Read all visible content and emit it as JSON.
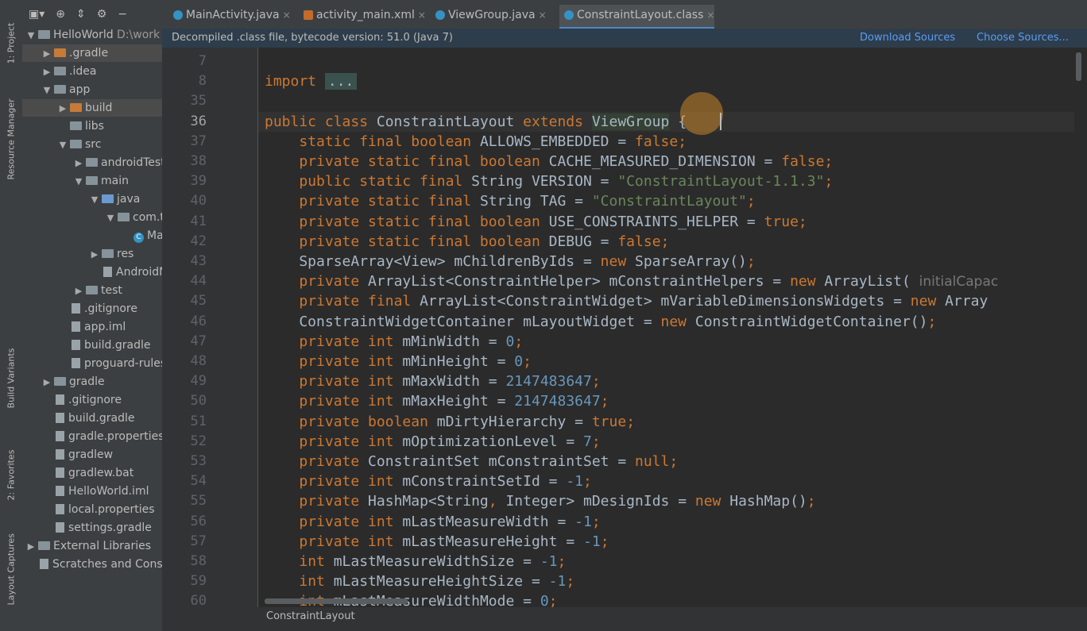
{
  "tool_windows": {
    "project": "1: Project",
    "resource_manager": "Resource Manager",
    "build_variants": "Build Variants",
    "favorites": "2: Favorites",
    "layout_captures": "Layout Captures"
  },
  "project_tree": [
    {
      "label": "HelloWorld",
      "extra": "D:\\work",
      "depth": 0,
      "arrow": "▼",
      "icon": "folder"
    },
    {
      "label": ".gradle",
      "depth": 1,
      "arrow": "▶",
      "icon": "folder-orange",
      "selected": true
    },
    {
      "label": ".idea",
      "depth": 1,
      "arrow": "▶",
      "icon": "folder"
    },
    {
      "label": "app",
      "depth": 1,
      "arrow": "▼",
      "icon": "folder"
    },
    {
      "label": "build",
      "depth": 2,
      "arrow": "▶",
      "icon": "folder-orange",
      "selected": true
    },
    {
      "label": "libs",
      "depth": 2,
      "arrow": "",
      "icon": "folder"
    },
    {
      "label": "src",
      "depth": 2,
      "arrow": "▼",
      "icon": "folder"
    },
    {
      "label": "androidTest",
      "depth": 3,
      "arrow": "▶",
      "icon": "folder"
    },
    {
      "label": "main",
      "depth": 3,
      "arrow": "▼",
      "icon": "folder"
    },
    {
      "label": "java",
      "depth": 4,
      "arrow": "▼",
      "icon": "folder-blue"
    },
    {
      "label": "com.t",
      "depth": 5,
      "arrow": "▼",
      "icon": "folder"
    },
    {
      "label": "Ma",
      "depth": 6,
      "arrow": "",
      "icon": "class"
    },
    {
      "label": "res",
      "depth": 4,
      "arrow": "▶",
      "icon": "folder"
    },
    {
      "label": "AndroidM",
      "depth": 4,
      "arrow": "",
      "icon": "file"
    },
    {
      "label": "test",
      "depth": 3,
      "arrow": "▶",
      "icon": "folder"
    },
    {
      "label": ".gitignore",
      "depth": 2,
      "arrow": "",
      "icon": "file"
    },
    {
      "label": "app.iml",
      "depth": 2,
      "arrow": "",
      "icon": "file"
    },
    {
      "label": "build.gradle",
      "depth": 2,
      "arrow": "",
      "icon": "file"
    },
    {
      "label": "proguard-rules",
      "depth": 2,
      "arrow": "",
      "icon": "file"
    },
    {
      "label": "gradle",
      "depth": 1,
      "arrow": "▶",
      "icon": "folder"
    },
    {
      "label": ".gitignore",
      "depth": 1,
      "arrow": "",
      "icon": "file"
    },
    {
      "label": "build.gradle",
      "depth": 1,
      "arrow": "",
      "icon": "file"
    },
    {
      "label": "gradle.properties",
      "depth": 1,
      "arrow": "",
      "icon": "file"
    },
    {
      "label": "gradlew",
      "depth": 1,
      "arrow": "",
      "icon": "file"
    },
    {
      "label": "gradlew.bat",
      "depth": 1,
      "arrow": "",
      "icon": "file"
    },
    {
      "label": "HelloWorld.iml",
      "depth": 1,
      "arrow": "",
      "icon": "file"
    },
    {
      "label": "local.properties",
      "depth": 1,
      "arrow": "",
      "icon": "file"
    },
    {
      "label": "settings.gradle",
      "depth": 1,
      "arrow": "",
      "icon": "file"
    },
    {
      "label": "External Libraries",
      "depth": 0,
      "arrow": "▶",
      "icon": "lib"
    },
    {
      "label": "Scratches and Conso",
      "depth": 0,
      "arrow": "",
      "icon": "file"
    }
  ],
  "tabs": [
    {
      "label": "MainActivity.java",
      "icon": "class-icon",
      "close": "×"
    },
    {
      "label": "activity_main.xml",
      "icon": "xml-icon",
      "close": "×"
    },
    {
      "label": "ViewGroup.java",
      "icon": "class-icon",
      "close": "×"
    },
    {
      "label": "ConstraintLayout.class",
      "icon": "class-icon",
      "close": "×",
      "active": true
    }
  ],
  "banner": {
    "text": "Decompiled .class file, bytecode version: 51.0 (Java 7)",
    "download": "Download Sources",
    "choose": "Choose Sources..."
  },
  "line_numbers": [
    "7",
    "8",
    "35",
    "36",
    "37",
    "38",
    "39",
    "40",
    "41",
    "42",
    "43",
    "44",
    "45",
    "46",
    "47",
    "48",
    "49",
    "50",
    "51",
    "52",
    "53",
    "54",
    "55",
    "56",
    "57",
    "58",
    "59",
    "60"
  ],
  "current_line": "36",
  "breadcrumb": "ConstraintLayout",
  "colors": {
    "keyword": "#cc7832",
    "string": "#6a8759",
    "number": "#6897bb",
    "text": "#a9b7c6",
    "accent": "#4a88c7"
  },
  "code_lines": [
    [],
    [
      {
        "t": "import",
        "c": "kw"
      },
      {
        "t": " "
      },
      {
        "t": "...",
        "c": "fold"
      }
    ],
    [],
    [
      {
        "t": "public class",
        "c": "kw"
      },
      {
        "t": " ConstraintLayout "
      },
      {
        "t": "extends",
        "c": "kw"
      },
      {
        "t": " "
      },
      {
        "t": "ViewGroup",
        "c": "hl"
      },
      {
        "t": " {"
      }
    ],
    [
      {
        "t": "    "
      },
      {
        "t": "static final boolean",
        "c": "kw"
      },
      {
        "t": " ALLOWS_EMBEDDED = "
      },
      {
        "t": "false",
        "c": "kw"
      },
      {
        "t": ";",
        "c": "kw"
      }
    ],
    [
      {
        "t": "    "
      },
      {
        "t": "private static final boolean",
        "c": "kw"
      },
      {
        "t": " CACHE_MEASURED_DIMENSION = "
      },
      {
        "t": "false",
        "c": "kw"
      },
      {
        "t": ";",
        "c": "kw"
      }
    ],
    [
      {
        "t": "    "
      },
      {
        "t": "public static final",
        "c": "kw"
      },
      {
        "t": " String VERSION = "
      },
      {
        "t": "\"ConstraintLayout-1.1.3\"",
        "c": "st"
      },
      {
        "t": ";",
        "c": "kw"
      }
    ],
    [
      {
        "t": "    "
      },
      {
        "t": "private static final",
        "c": "kw"
      },
      {
        "t": " String TAG = "
      },
      {
        "t": "\"ConstraintLayout\"",
        "c": "st"
      },
      {
        "t": ";",
        "c": "kw"
      }
    ],
    [
      {
        "t": "    "
      },
      {
        "t": "private static final boolean",
        "c": "kw"
      },
      {
        "t": " USE_CONSTRAINTS_HELPER = "
      },
      {
        "t": "true",
        "c": "kw"
      },
      {
        "t": ";",
        "c": "kw"
      }
    ],
    [
      {
        "t": "    "
      },
      {
        "t": "private static final boolean",
        "c": "kw"
      },
      {
        "t": " DEBUG = "
      },
      {
        "t": "false",
        "c": "kw"
      },
      {
        "t": ";",
        "c": "kw"
      }
    ],
    [
      {
        "t": "    SparseArray<View> mChildrenByIds = "
      },
      {
        "t": "new",
        "c": "kw"
      },
      {
        "t": " SparseArray()"
      },
      {
        "t": ";",
        "c": "kw"
      }
    ],
    [
      {
        "t": "    "
      },
      {
        "t": "private",
        "c": "kw"
      },
      {
        "t": " ArrayList<ConstraintHelper> mConstraintHelpers = "
      },
      {
        "t": "new",
        "c": "kw"
      },
      {
        "t": " ArrayList( "
      },
      {
        "t": "initialCapac",
        "c": "hint"
      }
    ],
    [
      {
        "t": "    "
      },
      {
        "t": "private final",
        "c": "kw"
      },
      {
        "t": " ArrayList<ConstraintWidget> mVariableDimensionsWidgets = "
      },
      {
        "t": "new",
        "c": "kw"
      },
      {
        "t": " Array"
      }
    ],
    [
      {
        "t": "    ConstraintWidgetContainer mLayoutWidget = "
      },
      {
        "t": "new",
        "c": "kw"
      },
      {
        "t": " ConstraintWidgetContainer()"
      },
      {
        "t": ";",
        "c": "kw"
      }
    ],
    [
      {
        "t": "    "
      },
      {
        "t": "private int",
        "c": "kw"
      },
      {
        "t": " mMinWidth = "
      },
      {
        "t": "0",
        "c": "nm"
      },
      {
        "t": ";",
        "c": "kw"
      }
    ],
    [
      {
        "t": "    "
      },
      {
        "t": "private int",
        "c": "kw"
      },
      {
        "t": " mMinHeight = "
      },
      {
        "t": "0",
        "c": "nm"
      },
      {
        "t": ";",
        "c": "kw"
      }
    ],
    [
      {
        "t": "    "
      },
      {
        "t": "private int",
        "c": "kw"
      },
      {
        "t": " mMaxWidth = "
      },
      {
        "t": "2147483647",
        "c": "nm"
      },
      {
        "t": ";",
        "c": "kw"
      }
    ],
    [
      {
        "t": "    "
      },
      {
        "t": "private int",
        "c": "kw"
      },
      {
        "t": " mMaxHeight = "
      },
      {
        "t": "2147483647",
        "c": "nm"
      },
      {
        "t": ";",
        "c": "kw"
      }
    ],
    [
      {
        "t": "    "
      },
      {
        "t": "private boolean",
        "c": "kw"
      },
      {
        "t": " mDirtyHierarchy = "
      },
      {
        "t": "true",
        "c": "kw"
      },
      {
        "t": ";",
        "c": "kw"
      }
    ],
    [
      {
        "t": "    "
      },
      {
        "t": "private int",
        "c": "kw"
      },
      {
        "t": " mOptimizationLevel = "
      },
      {
        "t": "7",
        "c": "nm"
      },
      {
        "t": ";",
        "c": "kw"
      }
    ],
    [
      {
        "t": "    "
      },
      {
        "t": "private",
        "c": "kw"
      },
      {
        "t": " ConstraintSet mConstraintSet = "
      },
      {
        "t": "null",
        "c": "kw"
      },
      {
        "t": ";",
        "c": "kw"
      }
    ],
    [
      {
        "t": "    "
      },
      {
        "t": "private int",
        "c": "kw"
      },
      {
        "t": " mConstraintSetId = "
      },
      {
        "t": "-1",
        "c": "nm"
      },
      {
        "t": ";",
        "c": "kw"
      }
    ],
    [
      {
        "t": "    "
      },
      {
        "t": "private",
        "c": "kw"
      },
      {
        "t": " HashMap<String"
      },
      {
        "t": ",",
        "c": "kw"
      },
      {
        "t": " Integer> mDesignIds = "
      },
      {
        "t": "new",
        "c": "kw"
      },
      {
        "t": " HashMap()"
      },
      {
        "t": ";",
        "c": "kw"
      }
    ],
    [
      {
        "t": "    "
      },
      {
        "t": "private int",
        "c": "kw"
      },
      {
        "t": " mLastMeasureWidth = "
      },
      {
        "t": "-1",
        "c": "nm"
      },
      {
        "t": ";",
        "c": "kw"
      }
    ],
    [
      {
        "t": "    "
      },
      {
        "t": "private int",
        "c": "kw"
      },
      {
        "t": " mLastMeasureHeight = "
      },
      {
        "t": "-1",
        "c": "nm"
      },
      {
        "t": ";",
        "c": "kw"
      }
    ],
    [
      {
        "t": "    "
      },
      {
        "t": "int",
        "c": "kw"
      },
      {
        "t": " mLastMeasureWidthSize = "
      },
      {
        "t": "-1",
        "c": "nm"
      },
      {
        "t": ";",
        "c": "kw"
      }
    ],
    [
      {
        "t": "    "
      },
      {
        "t": "int",
        "c": "kw"
      },
      {
        "t": " mLastMeasureHeightSize = "
      },
      {
        "t": "-1",
        "c": "nm"
      },
      {
        "t": ";",
        "c": "kw"
      }
    ],
    [
      {
        "t": "    "
      },
      {
        "t": "int",
        "c": "kw"
      },
      {
        "t": " mLastMeasureWidthMode = "
      },
      {
        "t": "0",
        "c": "nm"
      },
      {
        "t": ";",
        "c": "kw"
      }
    ]
  ]
}
